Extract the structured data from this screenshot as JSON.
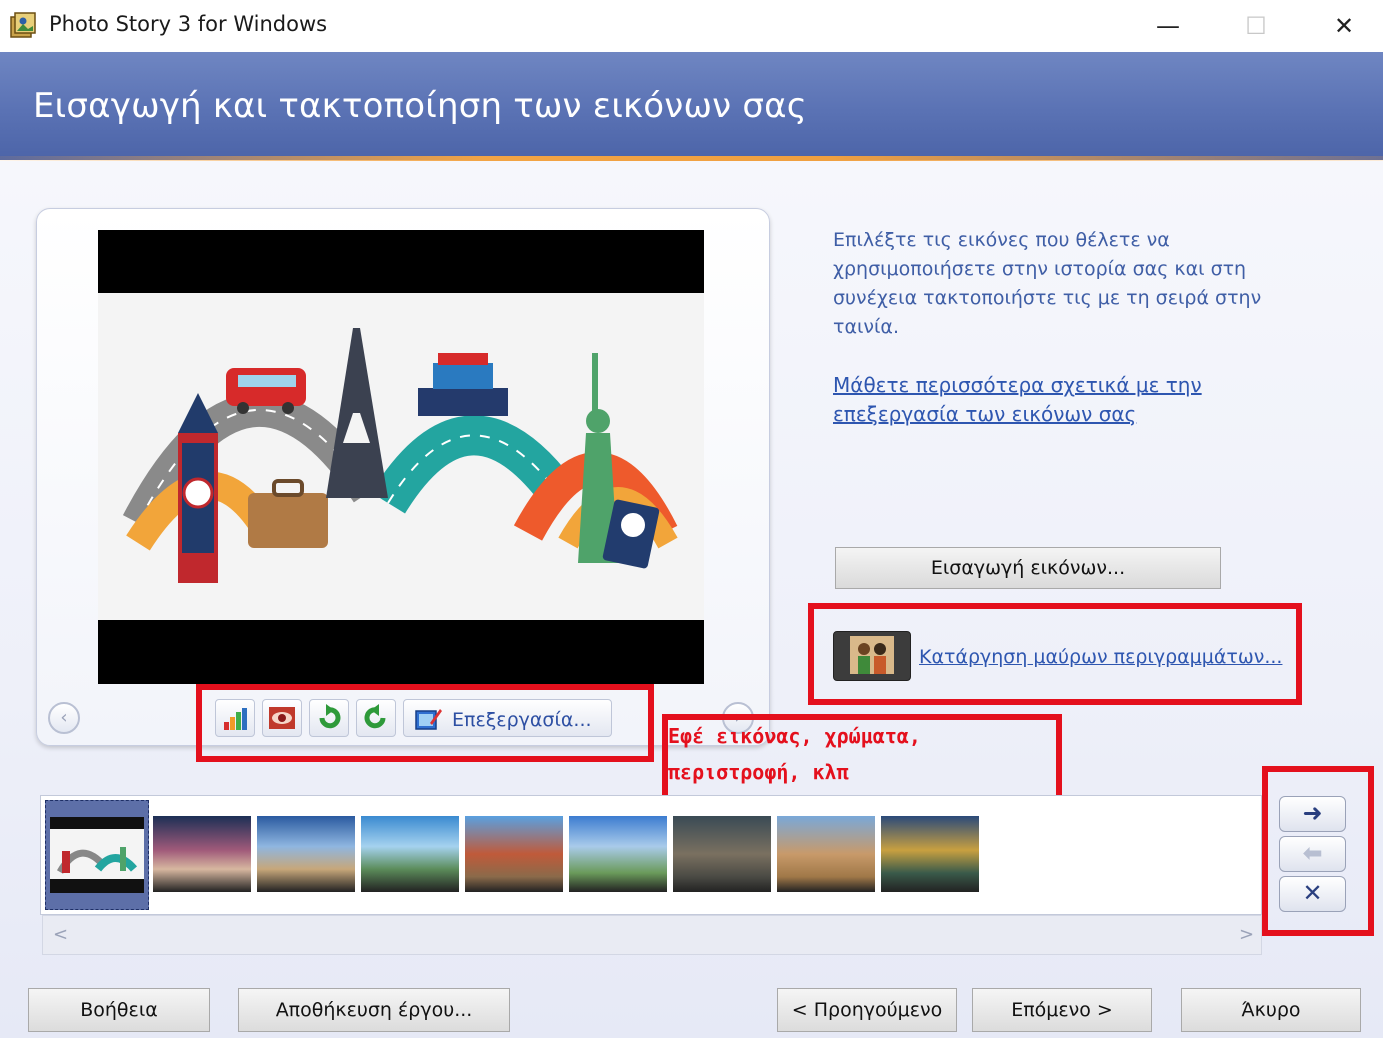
{
  "window": {
    "title": "Photo Story 3 for Windows",
    "minimize_glyph": "—",
    "maximize_glyph": "☐",
    "close_glyph": "✕"
  },
  "header": {
    "title": "Εισαγωγή και τακτοποίηση των εικόνων σας"
  },
  "preview": {
    "toolbar": {
      "tools": [
        {
          "icon": "auto-correct-levels-icon"
        },
        {
          "icon": "red-eye-icon"
        },
        {
          "icon": "rotate-left-icon"
        },
        {
          "icon": "rotate-right-icon"
        }
      ],
      "edit_label": "Επεξεργασία..."
    },
    "prev_glyph": "‹",
    "next_glyph": "›"
  },
  "sidepanel": {
    "instructions": "Επιλέξτε τις εικόνες που θέλετε να χρησιμοποιήσετε στην ιστορία σας και στη συνέχεια τακτοποιήστε τις με τη σειρά στην ταινία.",
    "learn_more": "Μάθετε περισσότερα σχετικά με την επεξεργασία των εικόνων σας",
    "import_button": "Εισαγωγή εικόνων...",
    "remove_borders": "Κατάργηση μαύρων περιγραμμάτων..."
  },
  "annotation": {
    "line1": "Εφέ εικόνας, χρώματα,",
    "line2": "περιστροφή, κλπ",
    "color": "#e4101d"
  },
  "filmstrip": {
    "thumbnails": [
      {
        "scene": "travel collage",
        "selected": true
      },
      {
        "scene": "bridge at dusk",
        "selected": false
      },
      {
        "scene": "arc de triomphe",
        "selected": false
      },
      {
        "scene": "chain bridge",
        "selected": false
      },
      {
        "scene": "old town rooftops",
        "selected": false
      },
      {
        "scene": "eiffel tower",
        "selected": false
      },
      {
        "scene": "stone square",
        "selected": false
      },
      {
        "scene": "colosseum",
        "selected": false
      },
      {
        "scene": "canal reflections",
        "selected": false
      }
    ],
    "scroll_left": "<",
    "scroll_right": ">"
  },
  "side_controls": {
    "move_right": "➜",
    "move_left": "⬅",
    "delete": "✕"
  },
  "footer": {
    "help": "Βοήθεια",
    "save_project": "Αποθήκευση έργου...",
    "previous": "< Προηγούμενο",
    "next": "Επόμενο >",
    "cancel": "Άκυρο"
  },
  "colors": {
    "header_blue": "#5a72b4",
    "link_blue": "#2e56b0",
    "annotation_red": "#e4101d"
  }
}
